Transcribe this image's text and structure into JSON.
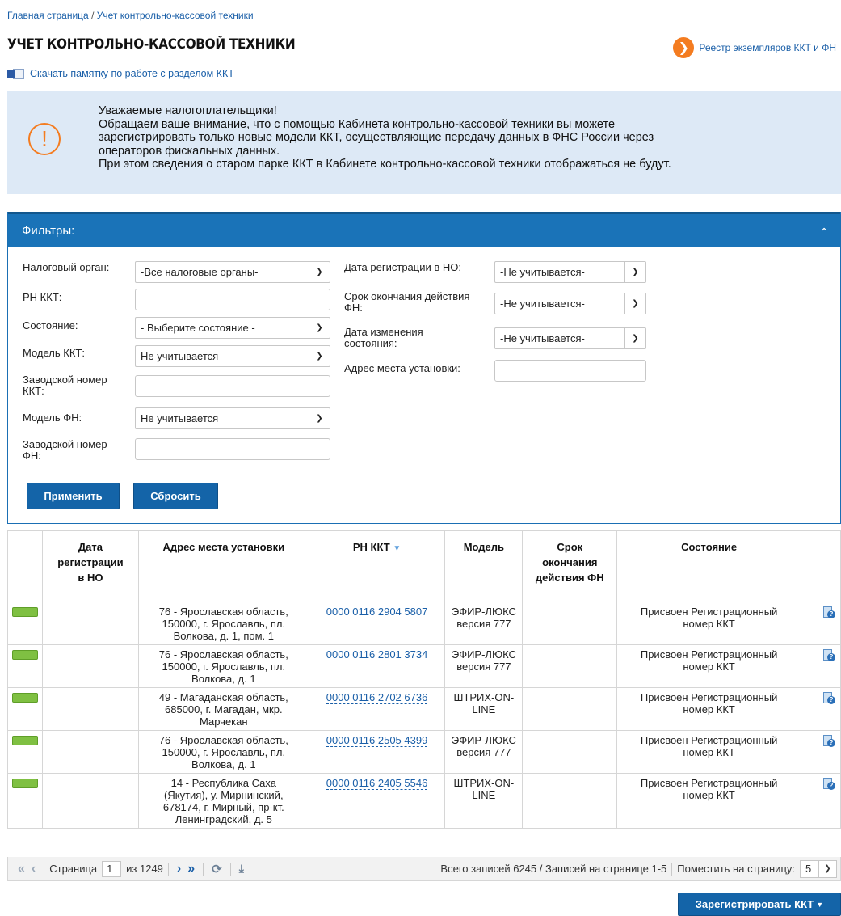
{
  "breadcrumb": {
    "home": "Главная страница",
    "separator": " / ",
    "current": "Учет контрольно-кассовой техники"
  },
  "page": {
    "title": "УЧЕТ КОНТРОЛЬНО-КАССОВОЙ ТЕХНИКИ"
  },
  "registry_link": {
    "label": "Реестр экземпляров ККТ и ФН",
    "icon": "arrow-right-icon"
  },
  "download_link": {
    "label": "Скачать памятку по работе с разделом ККТ",
    "icon": "word-doc-icon"
  },
  "notice": {
    "icon": "warning-icon",
    "lines": [
      "Уважаемые налогоплательщики!",
      "Обращаем ваше внимание, что с помощью Кабинета контрольно-кассовой техники вы можете",
      "зарегистрировать только новые модели ККТ, осуществляющие передачу данных в ФНС России через",
      "операторов фискальных данных.",
      "При этом сведения о старом парке ККТ в Кабинете контрольно-кассовой техники отображаться не будут."
    ]
  },
  "filters": {
    "title": "Фильтры:",
    "tax_office": {
      "label": "Налоговый орган:",
      "value": "-Все налоговые органы-"
    },
    "rn_kkt": {
      "label": "РН ККТ:",
      "value": ""
    },
    "state": {
      "label": "Состояние:",
      "value": "- Выберите состояние -"
    },
    "kkt_model": {
      "label": "Модель ККТ:",
      "value": "Не учитывается"
    },
    "kkt_serial": {
      "label_1": "Заводской номер",
      "label_2": "ККТ:",
      "value": ""
    },
    "fn_model": {
      "label": "Модель ФН:",
      "value": "Не учитывается"
    },
    "fn_serial": {
      "label_1": "Заводской номер",
      "label_2": "ФН:",
      "value": ""
    },
    "reg_date": {
      "label": "Дата регистрации в НО:",
      "value": "-Не учитывается-"
    },
    "fn_expiry": {
      "label_1": "Срок окончания действия",
      "label_2": "ФН:",
      "value": "-Не учитывается-"
    },
    "state_change_date": {
      "label_1": "Дата изменения",
      "label_2": "состояния:",
      "value": "-Не учитывается-"
    },
    "install_address": {
      "label": "Адрес места установки:",
      "value": ""
    },
    "apply_label": "Применить",
    "reset_label": "Сбросить"
  },
  "table": {
    "headers": {
      "reg_date": [
        "Дата",
        "регистрации",
        "в НО"
      ],
      "address": "Адрес места установки",
      "rn": "РН ККТ",
      "model": "Модель",
      "fn_expiry": [
        "Срок",
        "окончания",
        "действия ФН"
      ],
      "state": "Состояние"
    },
    "rows": [
      {
        "reg_date": "",
        "address": [
          "76 - Ярославская область,",
          "150000, г. Ярославль, пл.",
          "Волкова, д. 1, пом. 1"
        ],
        "rn": "0000 0116 2904 5807",
        "model": [
          "ЭФИР-ЛЮКС",
          "версия 777"
        ],
        "fn_expiry": "",
        "state": [
          "Присвоен Регистрационный",
          "номер ККТ"
        ]
      },
      {
        "reg_date": "",
        "address": [
          "76 - Ярославская область,",
          "150000, г. Ярославль, пл.",
          "Волкова, д. 1"
        ],
        "rn": "0000 0116 2801 3734",
        "model": [
          "ЭФИР-ЛЮКС",
          "версия 777"
        ],
        "fn_expiry": "",
        "state": [
          "Присвоен Регистрационный",
          "номер ККТ"
        ]
      },
      {
        "reg_date": "",
        "address": [
          "49 - Магаданская область,",
          "685000, г. Магадан, мкр.",
          "Марчекан"
        ],
        "rn": "0000 0116 2702 6736",
        "model": [
          "ШТРИХ-ON-",
          "LINE"
        ],
        "fn_expiry": "",
        "state": [
          "Присвоен Регистрационный",
          "номер ККТ"
        ]
      },
      {
        "reg_date": "",
        "address": [
          "76 - Ярославская область,",
          "150000, г. Ярославль, пл.",
          "Волкова, д. 1"
        ],
        "rn": "0000 0116 2505 4399",
        "model": [
          "ЭФИР-ЛЮКС",
          "версия 777"
        ],
        "fn_expiry": "",
        "state": [
          "Присвоен Регистрационный",
          "номер ККТ"
        ]
      },
      {
        "reg_date": "",
        "address": [
          "14 - Республика Саха",
          "(Якутия), у. Мирнинский,",
          "678174, г. Мирный, пр-кт.",
          "Ленинградский, д. 5"
        ],
        "rn": "0000 0116 2405 5546",
        "model": [
          "ШТРИХ-ON-",
          "LINE"
        ],
        "fn_expiry": "",
        "state": [
          "Присвоен Регистрационный",
          "номер ККТ"
        ]
      }
    ]
  },
  "pager": {
    "page_label": "Страница",
    "page_value": "1",
    "of_label": "из 1249",
    "summary": "Всего записей 6245 / Записей на странице 1-5",
    "per_page_label": "Поместить на страницу:",
    "per_page_value": "5"
  },
  "register_button": {
    "label": "Зарегистрировать ККТ"
  },
  "colors": {
    "primary": "#1464a8",
    "accent": "#f47c20",
    "status_ok": "#7fc042",
    "notice_bg": "#dde9f6"
  }
}
